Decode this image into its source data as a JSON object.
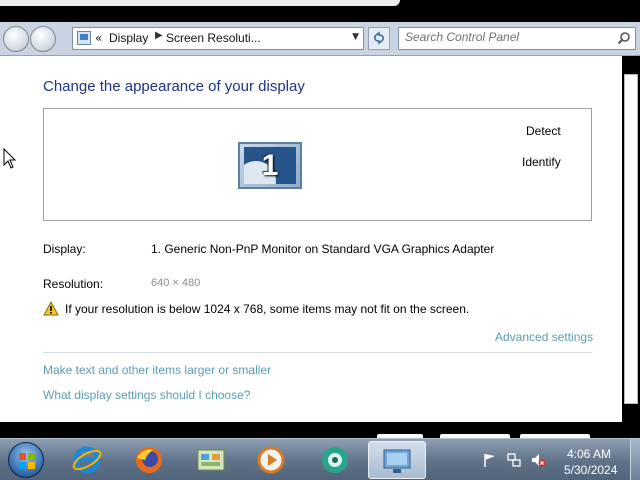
{
  "breadcrumb": {
    "overflow": "«",
    "items": [
      "Display",
      "Screen Resoluti..."
    ]
  },
  "search": {
    "placeholder": "Search Control Panel"
  },
  "page": {
    "title": "Change the appearance of your display",
    "monitor_number": "1",
    "detect": "Detect",
    "identify": "Identify",
    "display_label": "Display:",
    "display_value": "1. Generic Non-PnP Monitor on Standard VGA Graphics Adapter",
    "resolution_label": "Resolution:",
    "resolution_value": "640 × 480",
    "warning": "If your resolution is below 1024 x 768, some items may not fit on the screen.",
    "advanced_settings": "Advanced settings",
    "link_text_size": "Make text and other items larger or smaller",
    "link_display_help": "What display settings should I choose?"
  },
  "taskbar": {
    "items": [
      "internet-explorer-icon",
      "firefox-icon",
      "control-panel-icon",
      "media-player-icon",
      "app-icon",
      "screen-resolution-icon"
    ],
    "active_index": 5,
    "clock_time": "4:06 AM",
    "clock_date": "5/30/2024"
  },
  "colors": {
    "title": "#1e3287",
    "link": "#5b9db0",
    "taskbar": "#5f7288"
  }
}
